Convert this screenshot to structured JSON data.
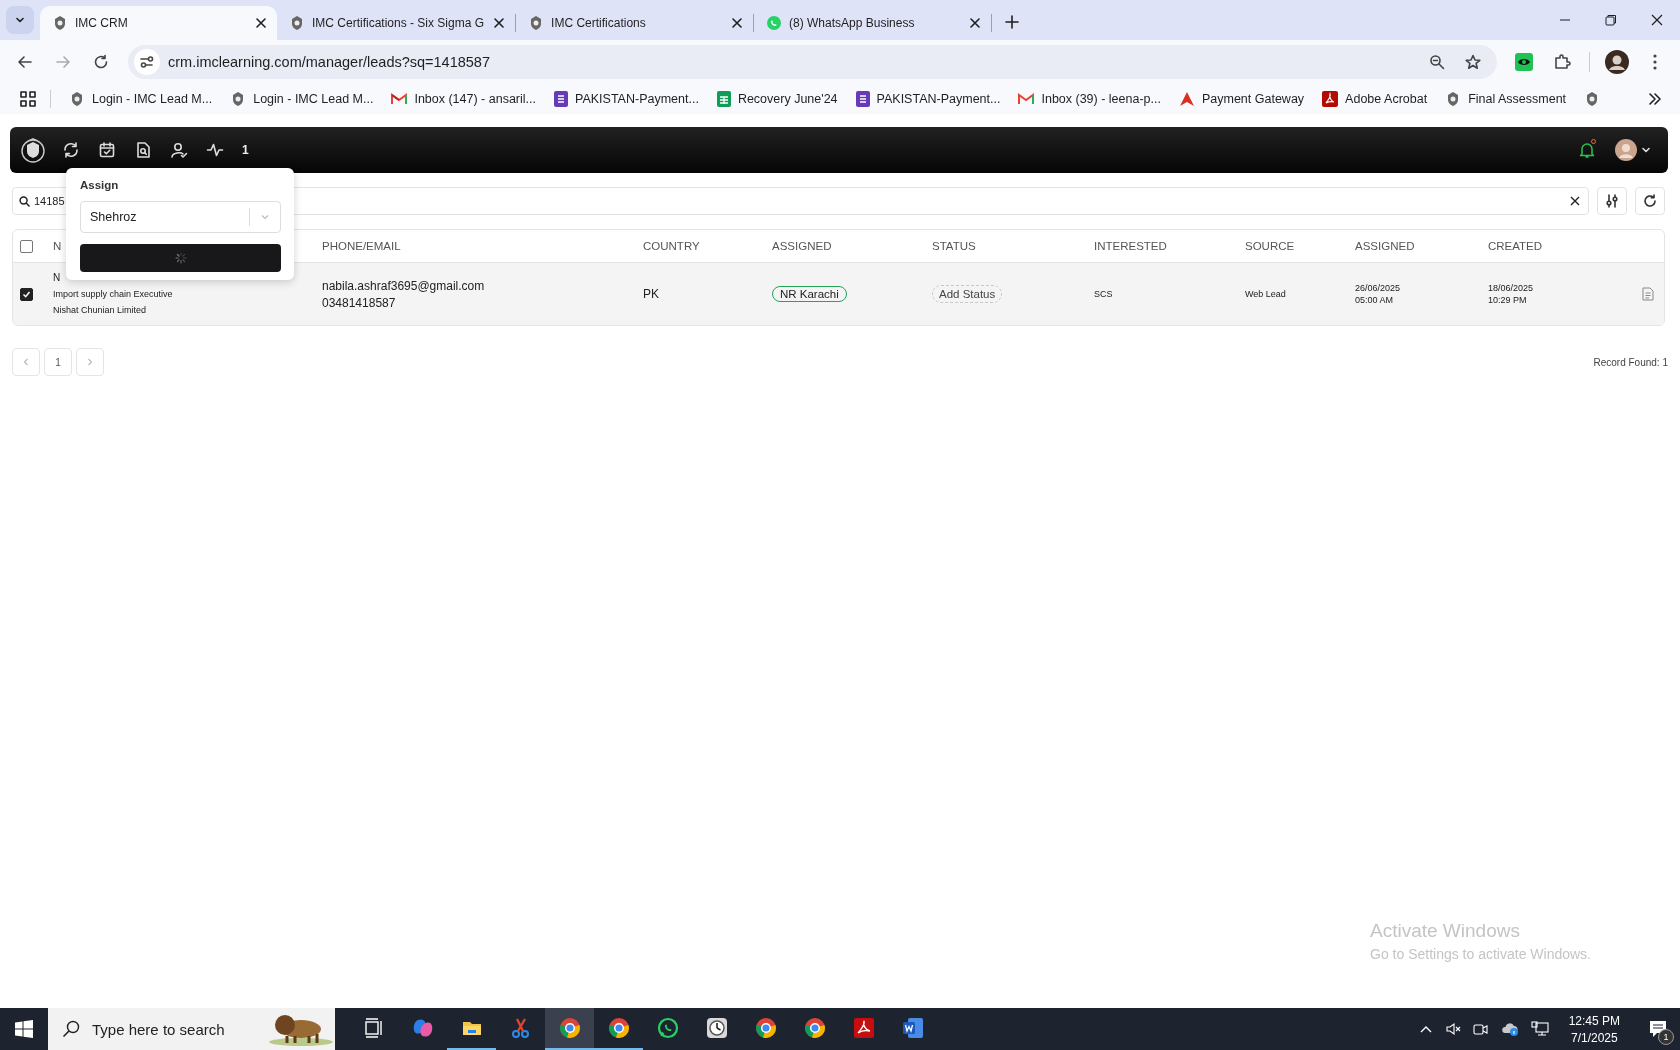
{
  "browser": {
    "tabs": [
      {
        "title": "IMC CRM",
        "selected": true
      },
      {
        "title": "IMC Certifications - Six Sigma G",
        "selected": false
      },
      {
        "title": "IMC Certifications",
        "selected": false
      },
      {
        "title": "(8) WhatsApp Business",
        "selected": false
      }
    ],
    "url": "crm.imclearning.com/manager/leads?sq=1418587",
    "bookmarks": [
      "Login - IMC Lead M...",
      "Login - IMC Lead M...",
      "Inbox (147) - ansaril...",
      "PAKISTAN-Payment...",
      "Recovery June'24",
      "PAKISTAN-Payment...",
      "Inbox (39) - leena-p...",
      "Payment Gateway",
      "Adobe Acrobat",
      "Final Assessment"
    ]
  },
  "crm": {
    "toolbar": {
      "counter": "1",
      "unread_notifications": true
    },
    "assign_popup": {
      "title": "Assign",
      "value": "Shehroz",
      "loading": true
    },
    "search": {
      "value": "14185"
    },
    "table": {
      "select_all": false,
      "columns": [
        "N",
        "PHONE/EMAIL",
        "COUNTRY",
        "ASSIGNED",
        "STATUS",
        "INTERESTED",
        "SOURCE",
        "ASSIGNED",
        "CREATED"
      ],
      "rows": [
        {
          "checked": true,
          "name": "N",
          "job_title": "Import supply chain Executive",
          "company": "Nishat Chunian Limited",
          "email": "nabila.ashraf3695@gmail.com",
          "phone": "03481418587",
          "country": "PK",
          "assigned_to": "NR Karachi",
          "status": "Add Status",
          "interested": "SCS",
          "source": "Web Lead",
          "assigned_date": "26/06/2025",
          "assigned_time": "05:00 AM",
          "created_date": "18/06/2025",
          "created_time": "10:29 PM"
        }
      ]
    },
    "pagination": {
      "pages": [
        "1"
      ]
    },
    "record_count": "Record Found: 1"
  },
  "os_notice": {
    "title": "Activate Windows",
    "message": "Go to Settings to activate Windows."
  },
  "taskbar": {
    "search_placeholder": "Type here to search",
    "apps": [
      {
        "running": false,
        "selected": false
      },
      {
        "running": false,
        "selected": false
      },
      {
        "running": true,
        "selected": false
      },
      {
        "running": false,
        "selected": false
      },
      {
        "running": true,
        "selected": true
      },
      {
        "running": true,
        "selected": false
      },
      {
        "running": false,
        "selected": false
      },
      {
        "running": false,
        "selected": false
      },
      {
        "running": false,
        "selected": false
      },
      {
        "running": false,
        "selected": false
      },
      {
        "running": false,
        "selected": false
      },
      {
        "running": false,
        "selected": false
      }
    ],
    "time": "12:45 PM",
    "date": "7/1/2025",
    "notification_count": "1"
  }
}
